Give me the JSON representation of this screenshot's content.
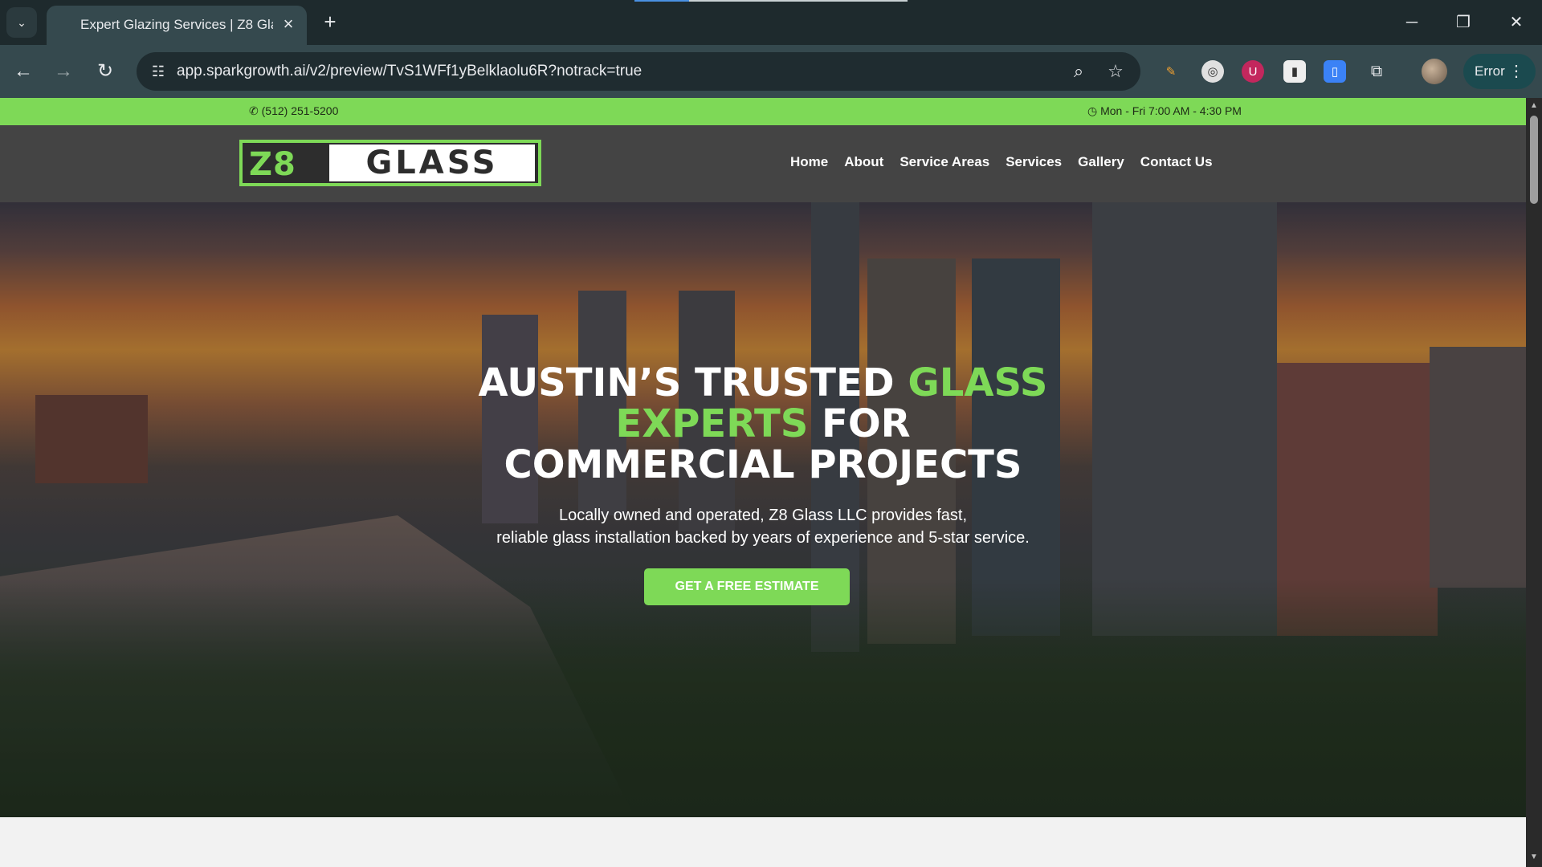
{
  "browser": {
    "tab_title": "Expert Glazing Services | Z8 Gla",
    "url": "app.sparkgrowth.ai/v2/preview/TvS1WFf1yBelklaolu6R?notrack=true",
    "profile_status": "Error"
  },
  "site": {
    "topbar": {
      "phone": "(512) 251-5200",
      "hours": "Mon - Fri 7:00 AM - 4:30 PM"
    },
    "logo": {
      "part1": "Z8",
      "part2": "GLASS"
    },
    "nav": [
      "Home",
      "About",
      "Service Areas",
      "Services",
      "Gallery",
      "Contact Us"
    ],
    "hero": {
      "title_1": "AUSTIN’S TRUSTED ",
      "title_green_1": "GLASS",
      "title_green_2": "EXPERTS",
      "title_2": " FOR",
      "title_3": "COMMERCIAL PROJECTS",
      "subtitle_1": "Locally owned and operated, Z8 Glass LLC provides fast,",
      "subtitle_2": "reliable glass installation backed by years of experience and 5-star service.",
      "cta": "GET A FREE ESTIMATE"
    }
  },
  "colors": {
    "brand_green": "#7ed957",
    "header_bg": "#444444",
    "chrome_bg": "#1e2a2d"
  }
}
